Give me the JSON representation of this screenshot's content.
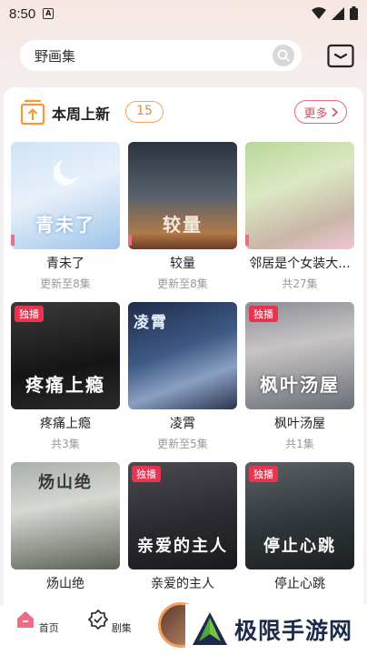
{
  "status_bar": {
    "time": "8:50",
    "notif_badge": "A"
  },
  "search": {
    "value": "野画集"
  },
  "section": {
    "title": "本周上新",
    "count": "15",
    "more_label": "更多"
  },
  "items": [
    {
      "title": "青未了",
      "sub": "更新至8集",
      "exclusive": "",
      "cover_text": "青未了"
    },
    {
      "title": "较量",
      "sub": "更新至8集",
      "exclusive": "",
      "cover_text": "较量"
    },
    {
      "title": "邻居是个女装大...",
      "sub": "共27集",
      "exclusive": "",
      "cover_text": ""
    },
    {
      "title": "疼痛上瘾",
      "sub": "共3集",
      "exclusive": "独播",
      "cover_text": "疼痛上瘾"
    },
    {
      "title": "凌霄",
      "sub": "更新至5集",
      "exclusive": "",
      "cover_text": "凌霄"
    },
    {
      "title": "枫叶汤屋",
      "sub": "共1集",
      "exclusive": "独播",
      "cover_text": "枫叶汤屋"
    },
    {
      "title": "炀山绝",
      "sub": "",
      "exclusive": "",
      "cover_text": "炀山绝"
    },
    {
      "title": "亲爱的主人",
      "sub": "",
      "exclusive": "独播",
      "cover_text": "亲爱的主人"
    },
    {
      "title": "停止心跳",
      "sub": "",
      "exclusive": "独播",
      "cover_text": "停止心跳"
    }
  ],
  "nav": {
    "home": "首页",
    "series": "剧集"
  },
  "watermark": {
    "text": "极限手游网"
  }
}
